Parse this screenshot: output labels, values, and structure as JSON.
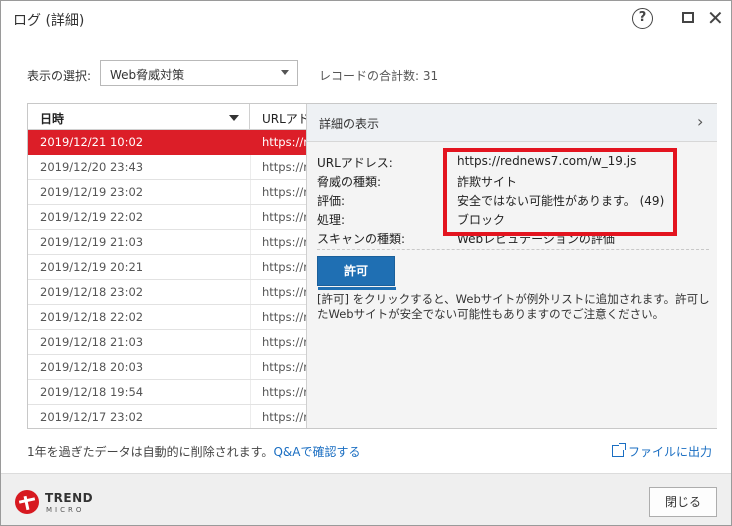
{
  "window": {
    "title": "ログ (詳細)",
    "help_glyph": "?",
    "close_glyph": "✕"
  },
  "filter": {
    "label": "表示の選択:",
    "selected": "Web脅威対策",
    "total": "レコードの合計数: 31"
  },
  "table": {
    "columns": [
      "日時",
      "URLアド"
    ],
    "rows": [
      {
        "date": "2019/12/21 10:02",
        "url": "https://r",
        "selected": true
      },
      {
        "date": "2019/12/20 23:43",
        "url": "https://r"
      },
      {
        "date": "2019/12/19 23:02",
        "url": "https://r"
      },
      {
        "date": "2019/12/19 22:02",
        "url": "https://r"
      },
      {
        "date": "2019/12/19 21:03",
        "url": "https://r"
      },
      {
        "date": "2019/12/19 20:21",
        "url": "https://r"
      },
      {
        "date": "2019/12/18 23:02",
        "url": "https://r"
      },
      {
        "date": "2019/12/18 22:02",
        "url": "https://r"
      },
      {
        "date": "2019/12/18 21:03",
        "url": "https://r"
      },
      {
        "date": "2019/12/18 20:03",
        "url": "https://r"
      },
      {
        "date": "2019/12/18 19:54",
        "url": "https://r"
      },
      {
        "date": "2019/12/17 23:02",
        "url": "https://r"
      }
    ]
  },
  "detail": {
    "header": "詳細の表示",
    "fields": [
      {
        "label": "URLアドレス:",
        "value": "https://rednews7.com/w_19.js"
      },
      {
        "label": "脅威の種類:",
        "value": "詐欺サイト"
      },
      {
        "label": "評価:",
        "value": "安全ではない可能性があります。 (49)"
      },
      {
        "label": "処理:",
        "value": "ブロック"
      },
      {
        "label": "スキャンの種類:",
        "value": "Webレピュテーションの評価"
      }
    ],
    "allow_button": "許可",
    "description": "[許可] をクリックすると、Webサイトが例外リストに追加されます。許可したWebサイトが安全でない可能性もありますのでご注意ください。",
    "highlight_color": "#e3141f"
  },
  "footer": {
    "auto_delete": "1年を過ぎたデータは自動的に削除されます。",
    "qa_link": "Q&Aで確認する",
    "export": "ファイルに出力",
    "close_button": "閉じる",
    "logo_line1": "TREND",
    "logo_line2": "MICRO"
  },
  "colors": {
    "accent_red": "#dc1e28",
    "link_blue": "#1a6ec2",
    "button_blue": "#1f6fb3"
  }
}
